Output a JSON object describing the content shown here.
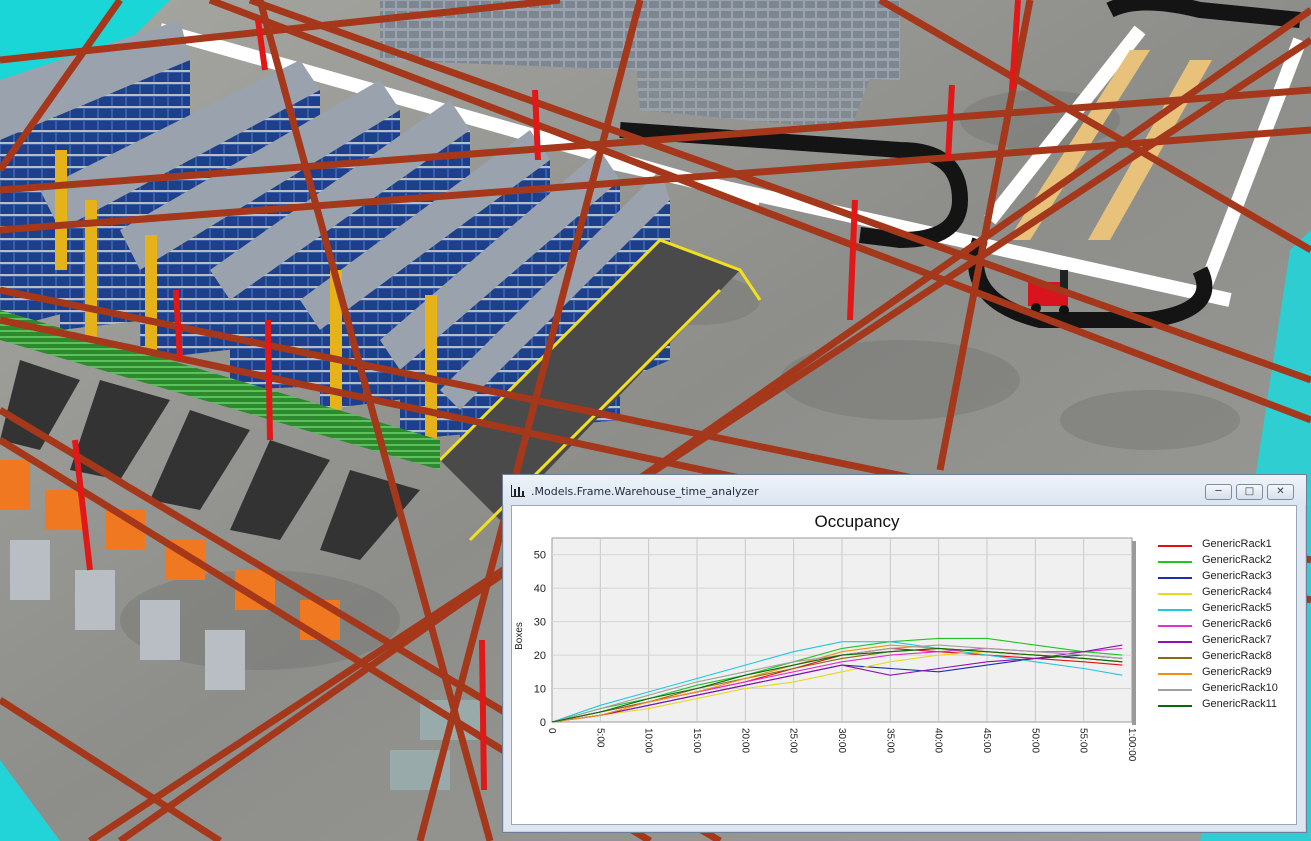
{
  "window": {
    "title": ".Models.Frame.Warehouse_time_analyzer",
    "icons": {
      "app": "chart-icon",
      "minimize": "minimize-icon",
      "maximize": "maximize-icon",
      "close": "close-icon"
    },
    "frame_color": "#dce5f0"
  },
  "chart_data": {
    "type": "line",
    "title": "Occupancy",
    "xlabel": "",
    "ylabel": "Boxes",
    "xlim": [
      0,
      60
    ],
    "ylim": [
      0,
      55
    ],
    "xticks": [
      0,
      5,
      10,
      15,
      20,
      25,
      30,
      35,
      40,
      45,
      50,
      55,
      60
    ],
    "xtick_labels": [
      "0",
      "5:00",
      "10:00",
      "15:00",
      "20:00",
      "25:00",
      "30:00",
      "35:00",
      "40:00",
      "45:00",
      "50:00",
      "55:00",
      "1:00:00"
    ],
    "yticks": [
      0,
      10,
      20,
      30,
      40,
      50
    ],
    "grid": true,
    "legend": "right",
    "x": [
      0,
      5,
      10,
      15,
      20,
      25,
      30,
      35,
      40,
      45,
      50,
      55,
      59
    ],
    "series": [
      {
        "name": "GenericRack1",
        "color": "#e01010",
        "values": [
          0,
          3,
          6,
          9,
          12,
          16,
          20,
          22,
          21,
          20,
          19,
          18,
          17
        ]
      },
      {
        "name": "GenericRack2",
        "color": "#22c422",
        "values": [
          0,
          4,
          7,
          11,
          14,
          18,
          22,
          24,
          25,
          25,
          23,
          21,
          20
        ]
      },
      {
        "name": "GenericRack3",
        "color": "#1a2fb0",
        "values": [
          0,
          2,
          5,
          8,
          11,
          14,
          17,
          16,
          15,
          17,
          19,
          20,
          19
        ]
      },
      {
        "name": "GenericRack4",
        "color": "#e8d820",
        "values": [
          0,
          2,
          4,
          7,
          10,
          12,
          15,
          18,
          20,
          21,
          20,
          19,
          18
        ]
      },
      {
        "name": "GenericRack5",
        "color": "#20c8e0",
        "values": [
          0,
          5,
          9,
          13,
          17,
          21,
          24,
          24,
          22,
          20,
          18,
          16,
          14
        ]
      },
      {
        "name": "GenericRack6",
        "color": "#e030d0",
        "values": [
          0,
          3,
          6,
          9,
          12,
          15,
          18,
          20,
          21,
          22,
          21,
          21,
          22
        ]
      },
      {
        "name": "GenericRack7",
        "color": "#9010b0",
        "values": [
          0,
          2,
          5,
          8,
          11,
          14,
          17,
          14,
          16,
          18,
          19,
          21,
          23
        ]
      },
      {
        "name": "GenericRack8",
        "color": "#8a6a10",
        "values": [
          0,
          3,
          6,
          10,
          13,
          16,
          19,
          21,
          22,
          21,
          20,
          19,
          18
        ]
      },
      {
        "name": "GenericRack9",
        "color": "#f09010",
        "values": [
          0,
          2,
          6,
          9,
          13,
          17,
          21,
          23,
          22,
          21,
          20,
          19,
          18
        ]
      },
      {
        "name": "GenericRack10",
        "color": "#a0a0a0",
        "values": [
          0,
          4,
          8,
          12,
          15,
          18,
          20,
          22,
          23,
          22,
          21,
          20,
          19
        ]
      },
      {
        "name": "GenericRack11",
        "color": "#0a6a0a",
        "values": [
          0,
          3,
          7,
          10,
          14,
          17,
          20,
          21,
          22,
          21,
          20,
          19,
          18
        ]
      }
    ]
  }
}
